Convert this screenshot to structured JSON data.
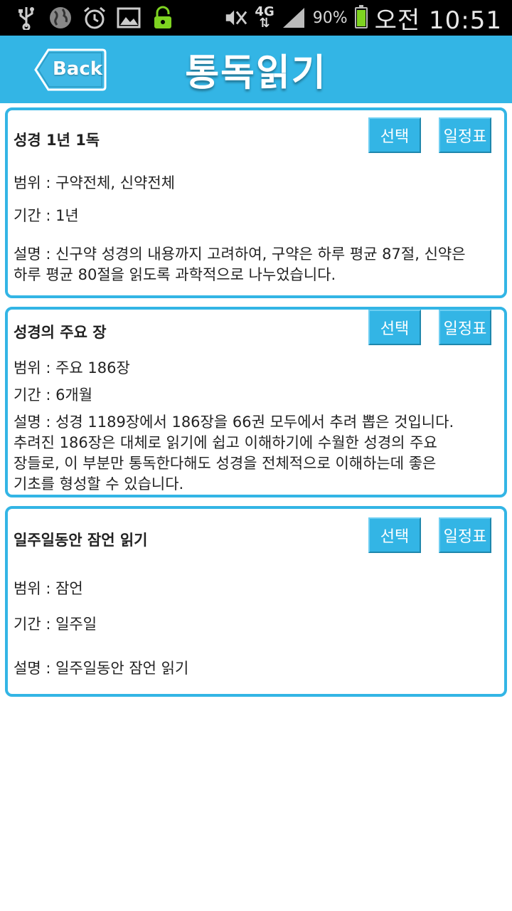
{
  "status_bar": {
    "signal_percent": "90%",
    "network": "4G",
    "time": "오전 10:51",
    "icons": [
      "usb-icon",
      "globe-icon",
      "alarm-icon",
      "gallery-icon",
      "lock-icon",
      "mute-icon",
      "signal-icon",
      "battery-icon"
    ],
    "battery_level": 0.9
  },
  "header": {
    "back_label": "Back",
    "title": "통독읽기",
    "color": "#33b5e5"
  },
  "plans": [
    {
      "title": "성경 1년 1독",
      "select_label": "선택",
      "schedule_label": "일정표",
      "range": "범위 : 구약전체, 신약전체",
      "period": "기간 : 1년",
      "desc_lines": [
        "설명 : 신구약 성경의 내용까지 고려하여, 구약은 하루 평균 87절, 신약은",
        "하루 평균 80절을 읽도록 과학적으로 나누었습니다."
      ]
    },
    {
      "title": "성경의 주요 장",
      "select_label": "선택",
      "schedule_label": "일정표",
      "range": "범위 : 주요 186장",
      "period": "기간 : 6개월",
      "desc_lines": [
        "설명 : 성경 1189장에서 186장을 66권 모두에서 추려 뽑은 것입니다.",
        "추려진 186장은 대체로 읽기에 쉽고 이해하기에 수월한 성경의 주요",
        "장들로, 이 부분만 통독한다해도 성경을 전체적으로 이해하는데 좋은",
        "기초를 형성할 수 있습니다."
      ]
    },
    {
      "title": "일주일동안 잠언 읽기",
      "select_label": "선택",
      "schedule_label": "일정표",
      "range": "범위 : 잠언",
      "period": "기간 : 일주일",
      "desc_lines": [
        "설명 : 일주일동안 잠언 읽기"
      ]
    }
  ]
}
